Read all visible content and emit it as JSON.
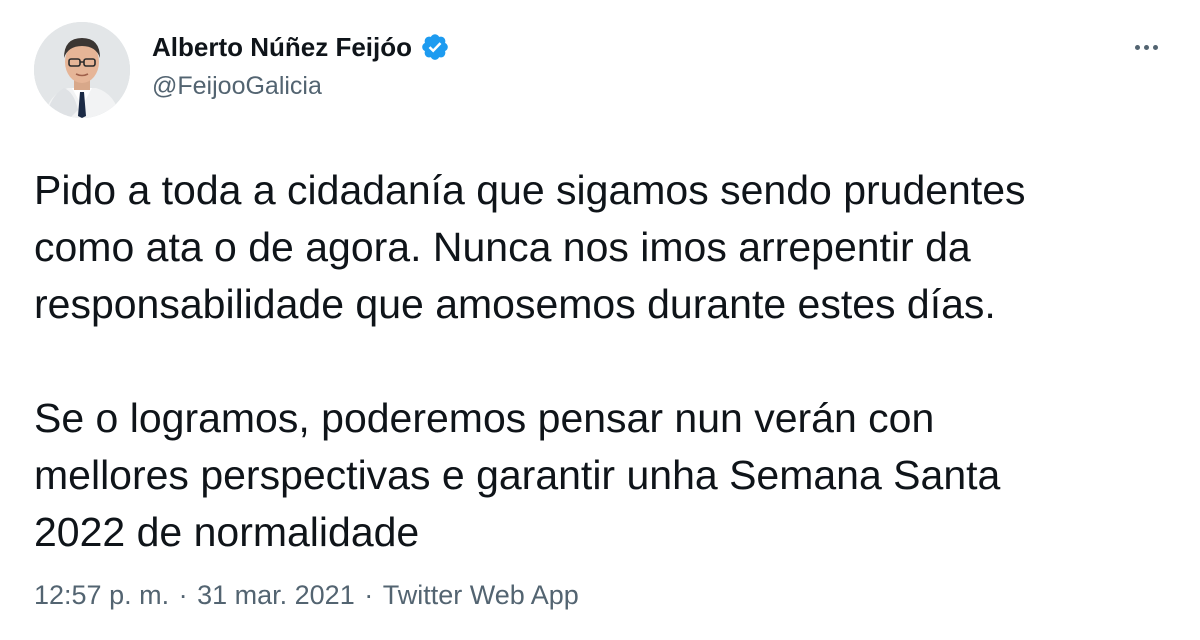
{
  "author": {
    "name": "Alberto Núñez Feijóo",
    "handle": "@FeijooGalicia",
    "avatar_icon": "profile-photo",
    "verified_icon": "verified-badge-icon",
    "verified_color": "#1d9bf0"
  },
  "tweet": {
    "lines": [
      "Pido a toda a cidadanía que sigamos sendo prudentes",
      "como ata o de agora. Nunca nos imos arrepentir da",
      "responsabilidade que amosemos durante estes días.",
      "Se o logramos, poderemos pensar nun verán con",
      "mellores perspectivas e garantir unha Semana Santa",
      "2022 de normalidade"
    ]
  },
  "meta": {
    "time": "12:57 p. m.",
    "separator": " · ",
    "date": "31 mar. 2021",
    "source": "Twitter Web App"
  },
  "colors": {
    "text": "#0f1419",
    "secondary": "#536471"
  }
}
